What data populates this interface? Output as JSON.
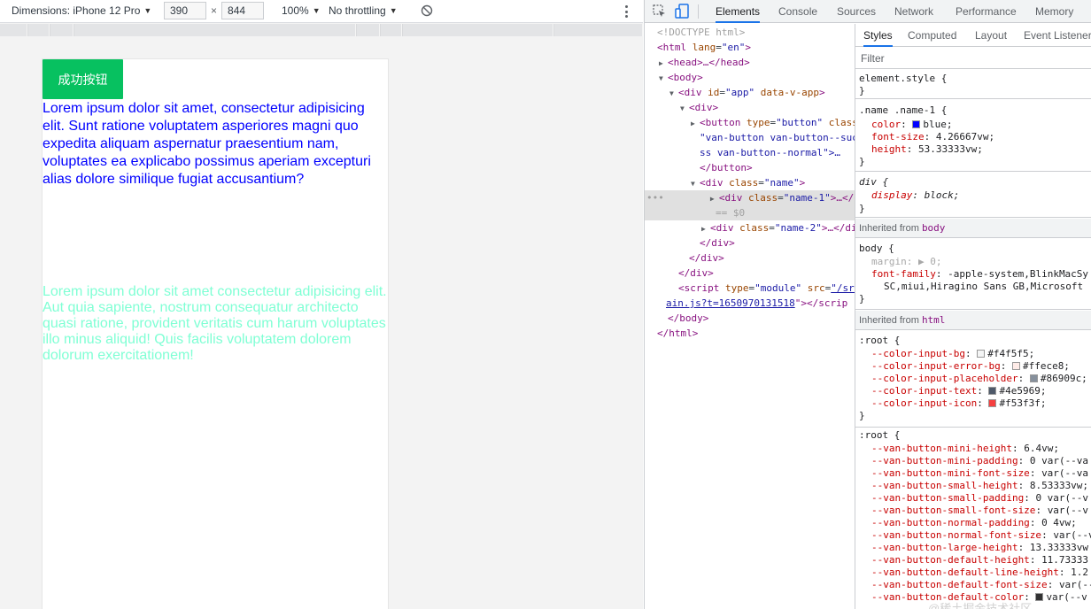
{
  "device_toolbar": {
    "dimensions_label": "Dimensions: iPhone 12 Pro",
    "width": "390",
    "height": "844",
    "times": "×",
    "zoom": "100%",
    "throttling": "No throttling"
  },
  "page": {
    "button_label": "成功按钮",
    "name1_text": "Lorem ipsum dolor sit amet, consectetur adipisicing elit. Sunt ratione voluptatem asperiores magni quo expedita aliquam aspernatur praesentium nam, voluptates ea explicabo possimus aperiam excepturi alias dolore similique fugiat accusantium?",
    "name1_color": "#0000ff",
    "name2_text": "Lorem ipsum dolor sit amet consectetur adipisicing elit. Aut quia sapiente, nostrum consequatur architecto quasi ratione, provident veritatis cum harum voluptates illo minus aliquid! Quis facilis voluptatem dolorem dolorum exercitationem!",
    "name2_color": "#7fffd4",
    "button_color": "#07c160"
  },
  "devtools": {
    "tabs": [
      "Elements",
      "Console",
      "Sources",
      "Network",
      "Performance",
      "Memory"
    ],
    "active_tab": "Elements",
    "styles_tabs": [
      "Styles",
      "Computed",
      "Layout",
      "Event Listeners"
    ],
    "filter_placeholder": "Filter",
    "dom": {
      "l1": "<!DOCTYPE html>",
      "l2_tag": "html",
      "l2_attr": "lang",
      "l2_val": "\"en\"",
      "l3": "<head>…</head>",
      "l4": "<body>",
      "l5_attr1": "id",
      "l5_val1": "\"app\"",
      "l5_attr2": "data-v-app",
      "l6": "<div>",
      "l7_tag": "<button",
      "l7_attr1": "type",
      "l7_val1": "\"button\"",
      "l7_attr2": "class",
      "l8": "\"van-button van-button--suc",
      "l9": "ss van-button--normal\">…",
      "l10": "</button>",
      "l11_attr": "class",
      "l11_val": "\"name\"",
      "l12_attr": "class",
      "l12_val": "\"name-1\"",
      "l12_rest": ">…</di",
      "l13": "== $0",
      "l14_attr": "class",
      "l14_val": "\"name-2\"",
      "l14_rest": ">…</di",
      "l15": "</div>",
      "l16": "</div>",
      "l17": "</div>",
      "l18_tag": "<script",
      "l18_attr1": "type",
      "l18_val1": "\"module\"",
      "l18_attr2": "src",
      "l18_link": "\"/src",
      "l19_link": "ain.js?t=1650970131518",
      "l19_rest": "\"></scrip",
      "l20": "</body>",
      "l21": "</html>",
      "dots": "•••"
    },
    "styles": {
      "element_style": "element.style {",
      "close": "}",
      "rule1_selector": ".name .name-1 {",
      "rule1_p1": "color",
      "rule1_v1": "blue;",
      "rule1_p2": "font-size",
      "rule1_v2": "4.26667vw;",
      "rule1_p3": "height",
      "rule1_v3": "53.33333vw;",
      "rule2_selector": "div {",
      "rule2_p1": "display",
      "rule2_v1": "block;",
      "inherited_body": "Inherited from",
      "inherited_body_tag": "body",
      "body_selector": "body {",
      "body_p1": "margin",
      "body_v1": "0;",
      "body_p2": "font-family",
      "body_v2": "-apple-system,BlinkMacSy",
      "body_v2b": "SC,miui,Hiragino Sans GB,Microsoft",
      "inherited_html": "Inherited from",
      "inherited_html_tag": "html",
      "root_selector": ":root {",
      "root_vars": [
        {
          "name": "--color-input-bg",
          "value": "#f4f5f5;",
          "swatch": "#f4f5f5"
        },
        {
          "name": "--color-input-error-bg",
          "value": "#ffece8;",
          "swatch": "#ffece8"
        },
        {
          "name": "--color-input-placeholder",
          "value": "#86909c;",
          "swatch": "#86909c"
        },
        {
          "name": "--color-input-text",
          "value": "#4e5969;",
          "swatch": "#4e5969"
        },
        {
          "name": "--color-input-icon",
          "value": "#f53f3f;",
          "swatch": "#f53f3f"
        }
      ],
      "root2_vars": [
        {
          "name": "--van-button-mini-height",
          "value": "6.4vw;"
        },
        {
          "name": "--van-button-mini-padding",
          "value": "0 var(--va"
        },
        {
          "name": "--van-button-mini-font-size",
          "value": "var(--va"
        },
        {
          "name": "--van-button-small-height",
          "value": "8.53333vw;"
        },
        {
          "name": "--van-button-small-padding",
          "value": "0 var(--v"
        },
        {
          "name": "--van-button-small-font-size",
          "value": "var(--v"
        },
        {
          "name": "--van-button-normal-padding",
          "value": "0 4vw;"
        },
        {
          "name": "--van-button-normal-font-size",
          "value": "var(--v"
        },
        {
          "name": "--van-button-large-height",
          "value": "13.33333vw"
        },
        {
          "name": "--van-button-default-height",
          "value": "11.73333"
        },
        {
          "name": "--van-button-default-line-height",
          "value": "1.2"
        },
        {
          "name": "--van-button-default-font-size",
          "value": "var(--"
        },
        {
          "name": "--van-button-default-color",
          "value": "var(--v",
          "swatch": "#323233"
        }
      ]
    }
  },
  "watermark": "@稀土掘金技术社区"
}
